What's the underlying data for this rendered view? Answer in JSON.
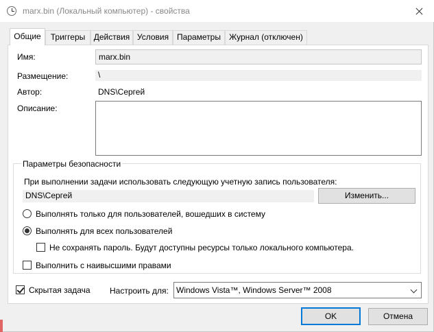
{
  "window": {
    "title": "marx.bin (Локальный компьютер) - свойства"
  },
  "tabs": [
    {
      "label": "Общие",
      "active": true
    },
    {
      "label": "Триггеры"
    },
    {
      "label": "Действия"
    },
    {
      "label": "Условия"
    },
    {
      "label": "Параметры"
    },
    {
      "label": "Журнал (отключен)"
    }
  ],
  "general": {
    "name_label": "Имя:",
    "name_value": "marx.bin",
    "location_label": "Размещение:",
    "location_value": "\\",
    "author_label": "Автор:",
    "author_value": "DNS\\Сергей",
    "description_label": "Описание:",
    "description_value": ""
  },
  "security": {
    "group_title": "Параметры безопасности",
    "account_prompt": "При выполнении задачи использовать следующую учетную запись пользователя:",
    "account_value": "DNS\\Сергей",
    "change_button": "Изменить...",
    "radio_logged_on": "Выполнять только для пользователей, вошедших в систему",
    "radio_all_users": "Выполнять для всех пользователей",
    "selected_radio": "all_users",
    "no_store_password": "Не сохранять пароль. Будут доступны ресурсы только локального компьютера.",
    "no_store_password_checked": false,
    "highest_privileges": "Выполнить с наивысшими правами",
    "highest_privileges_checked": false
  },
  "bottom": {
    "hidden_task": "Скрытая задача",
    "hidden_task_checked": true,
    "configure_for_label": "Настроить для:",
    "configure_for_value": "Windows Vista™, Windows Server™ 2008"
  },
  "buttons": {
    "ok": "OK",
    "cancel": "Отмена"
  },
  "colors": {
    "accent": "#0078d7",
    "panel": "#ffffff",
    "window": "#f0f0f0"
  }
}
